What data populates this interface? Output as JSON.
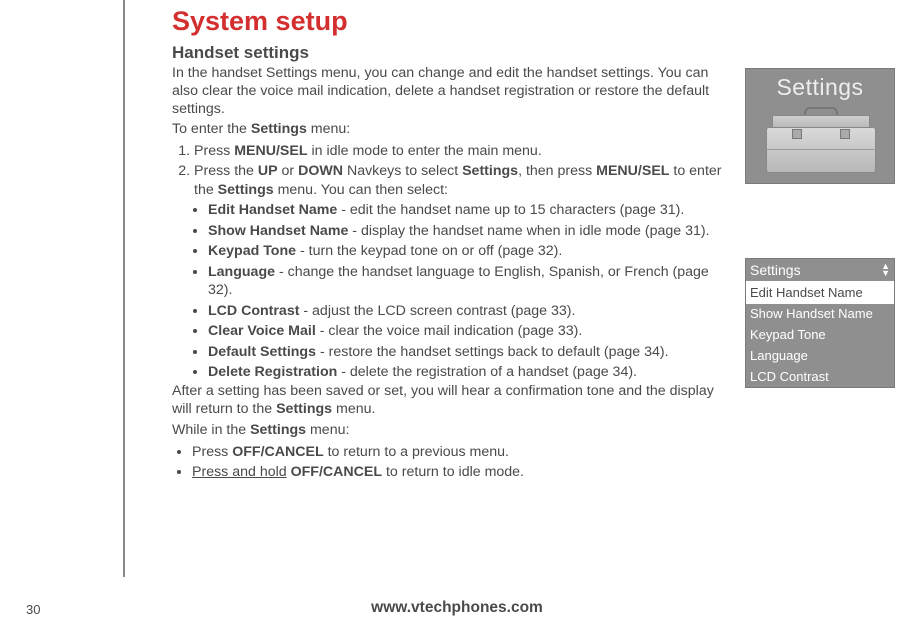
{
  "title": "System setup",
  "subtitle": "Handset settings",
  "intro": "In the handset Settings menu, you can change and edit the handset settings. You can also clear the voice mail indication, delete a handset registration or restore the default settings.",
  "enter_line": "To enter the Settings menu:",
  "step1": {
    "prefix": "Press ",
    "key": "MENU/SEL",
    "suffix": " in idle mode to enter the main menu."
  },
  "step2": {
    "a": "Press the ",
    "up": "UP",
    "b": " or ",
    "down": "DOWN",
    "c": " Navkeys to select ",
    "settings": "Settings",
    "d": ", then press ",
    "menusel": "MENU/SEL",
    "e": " to enter the ",
    "settings2": "Settings",
    "f": " menu. You can then select:"
  },
  "options": [
    {
      "name": "Edit Handset Name",
      "desc": " - edit the handset name up to 15 characters (page 31)."
    },
    {
      "name": "Show Handset Name",
      "desc": " - display the handset name when in idle mode (page 31)."
    },
    {
      "name": "Keypad Tone",
      "desc": " - turn the keypad tone on or off (page 32)."
    },
    {
      "name": "Language",
      "desc": " - change the handset language to English, Spanish, or French (page 32)."
    },
    {
      "name": "LCD Contrast",
      "desc": " - adjust the LCD screen contrast (page 33)."
    },
    {
      "name": "Clear Voice Mail",
      "desc": " - clear the voice mail indication (page 33)."
    },
    {
      "name": "Default Settings",
      "desc": " - restore the handset settings back to default (page 34)."
    },
    {
      "name": "Delete Registration",
      "desc": " - delete the registration of a handset (page 34)."
    }
  ],
  "after": {
    "a": "After a setting has been saved or set, you will hear a confirmation tone and the display will return to the ",
    "settings": "Settings",
    "b": " menu."
  },
  "while_line": {
    "a": "While in the ",
    "settings": "Settings",
    "b": " menu:"
  },
  "nav1": {
    "a": "Press ",
    "key": "OFF/CANCEL",
    "b": " to return to a previous menu."
  },
  "nav2": {
    "underline": "Press and hold",
    "a": " ",
    "key": "OFF/CANCEL",
    "b": " to return to idle mode."
  },
  "hero_title": "Settings",
  "screen": {
    "header": "Settings",
    "rows": [
      "Edit Handset Name",
      "Show Handset Name",
      "Keypad Tone",
      "Language",
      "LCD Contrast"
    ]
  },
  "page_number": "30",
  "footer_url": "www.vtechphones.com"
}
